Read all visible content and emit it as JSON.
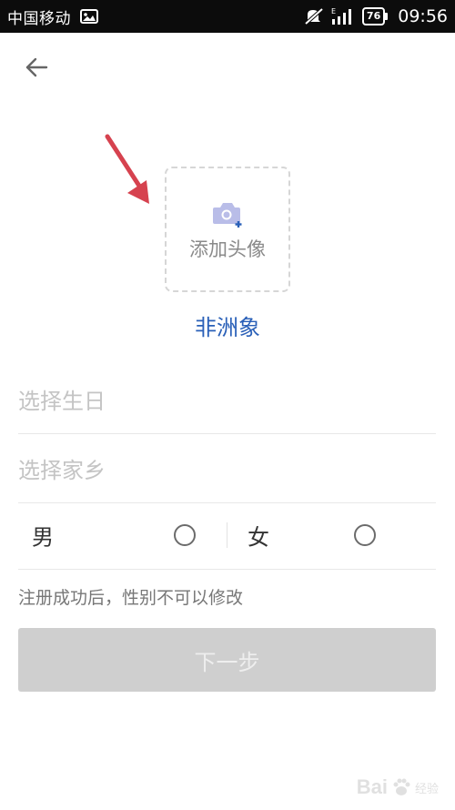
{
  "status_bar": {
    "carrier": "中国移动",
    "battery": "76",
    "time": "09:56",
    "icons": [
      "image-icon",
      "muted-icon",
      "signal-icon",
      "battery-icon"
    ]
  },
  "header": {
    "back_icon": "back-arrow-icon"
  },
  "avatar": {
    "label": "添加头像",
    "icon": "camera-add-icon"
  },
  "profile": {
    "nickname": "非洲象"
  },
  "fields": {
    "birthday_placeholder": "选择生日",
    "hometown_placeholder": "选择家乡"
  },
  "gender": {
    "male": "男",
    "female": "女",
    "note": "注册成功后，性别不可以修改"
  },
  "actions": {
    "next_label": "下一步"
  },
  "watermark": {
    "text": "Bai",
    "sub": "经验"
  },
  "colors": {
    "accent": "#2a60b8",
    "annotation": "#d6424f",
    "button_disabled": "#cfcfcf"
  }
}
